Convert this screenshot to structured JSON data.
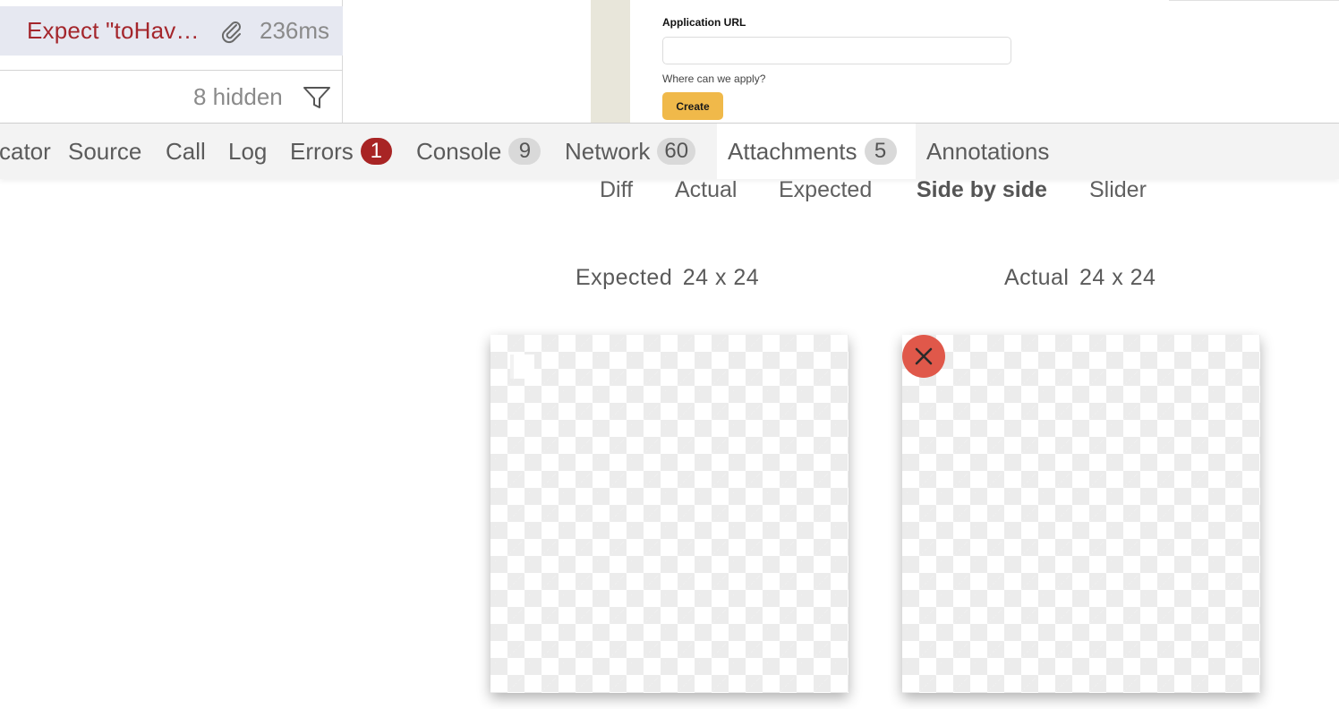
{
  "actions_list": {
    "selected_action": {
      "title": "Expect \"toHav…",
      "duration": "236ms",
      "attachment_icon": "paperclip-icon"
    },
    "hidden_count": "8 hidden",
    "filter_icon": "filter-icon"
  },
  "snapshot": {
    "field_label": "Application URL",
    "field_value": "",
    "help_text": "Where can we apply?",
    "create_button": "Create"
  },
  "tabs": [
    {
      "label": "cator"
    },
    {
      "label": "Source"
    },
    {
      "label": "Call"
    },
    {
      "label": "Log"
    },
    {
      "label": "Errors",
      "count": "1"
    },
    {
      "label": "Console",
      "count": "9"
    },
    {
      "label": "Network",
      "count": "60"
    },
    {
      "label": "Attachments",
      "count": "5",
      "active": true
    },
    {
      "label": "Annotations"
    }
  ],
  "view_modes": {
    "options": [
      "Diff",
      "Actual",
      "Expected",
      "Side by side",
      "Slider"
    ],
    "selected": "Side by side"
  },
  "images": {
    "expected": {
      "label": "Expected",
      "dims": "24 x 24"
    },
    "actual": {
      "label": "Actual",
      "dims": "24 x 24",
      "overlay_icon": "close-icon"
    }
  },
  "colors": {
    "error_text": "#a4262c",
    "error_badge": "#a82424",
    "selected_row": "#e6e8f1",
    "create_button": "#f0b94a",
    "close_badge": "#e0584a"
  }
}
